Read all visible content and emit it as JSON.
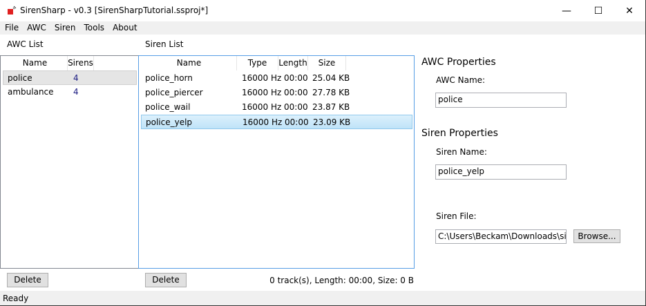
{
  "window": {
    "title": "SirenSharp - v0.3 [SirenSharpTutorial.ssproj*]",
    "minimize": "—",
    "maximize": "☐",
    "close": "✕"
  },
  "menu": [
    "File",
    "AWC",
    "Siren",
    "Tools",
    "About"
  ],
  "awc_list": {
    "label": "AWC List",
    "columns": [
      "Name",
      "Sirens"
    ],
    "rows": [
      {
        "name": "police",
        "sirens": "4",
        "selected": true
      },
      {
        "name": "ambulance",
        "sirens": "4"
      }
    ],
    "delete_label": "Delete"
  },
  "siren_list": {
    "label": "Siren List",
    "columns": [
      "Name",
      "Type",
      "Length",
      "Size"
    ],
    "rows": [
      {
        "name": "police_horn",
        "type": "16000 Hz",
        "length": "00:00",
        "size": "25.04 KB"
      },
      {
        "name": "police_piercer",
        "type": "16000 Hz",
        "length": "00:00",
        "size": "27.78 KB"
      },
      {
        "name": "police_wail",
        "type": "16000 Hz",
        "length": "00:00",
        "size": "23.87 KB"
      },
      {
        "name": "police_yelp",
        "type": "16000 Hz",
        "length": "00:00",
        "size": "23.09 KB",
        "selected": true
      }
    ],
    "delete_label": "Delete",
    "summary": "0 track(s), Length: 00:00, Size: 0 B"
  },
  "awc_properties": {
    "heading": "AWC Properties",
    "name_label": "AWC Name:",
    "name_value": "police"
  },
  "siren_properties": {
    "heading": "Siren Properties",
    "name_label": "Siren Name:",
    "name_value": "police_yelp",
    "file_label": "Siren File:",
    "file_value": "C:\\Users\\Beckam\\Downloads\\sirens",
    "browse_label": "Browse..."
  },
  "status": {
    "text": "Ready"
  },
  "colors": {
    "selection_blue": "#cce8ff",
    "selection_gray": "#e5e5e5",
    "focus_border": "#569de5"
  }
}
